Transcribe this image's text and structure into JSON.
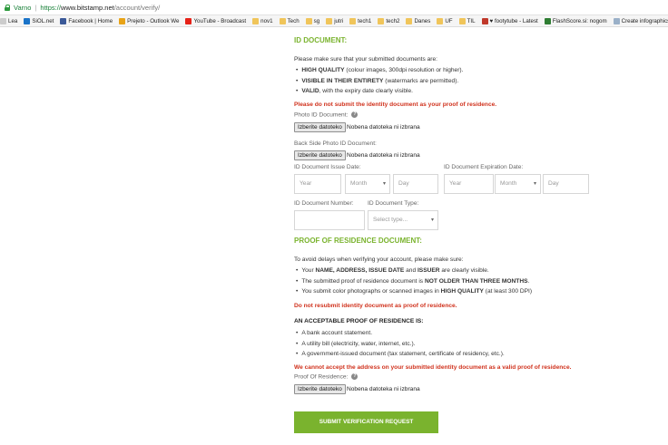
{
  "browser": {
    "security_label": "Varno",
    "url_scheme": "https://",
    "url_domain": "www.bitstamp.net",
    "url_path": "/account/verify/"
  },
  "bookmarks": [
    {
      "label": "Lea",
      "icon": "app-icon",
      "color": "#cccccc"
    },
    {
      "label": "SiOL.net",
      "icon": "siol-icon",
      "color": "#1a73c8"
    },
    {
      "label": "Facebook | Home",
      "icon": "facebook-icon",
      "color": "#3b5998"
    },
    {
      "label": "Prejeto - Outlook We",
      "icon": "outlook-icon",
      "color": "#e8a317"
    },
    {
      "label": "YouTube - Broadcast",
      "icon": "youtube-icon",
      "color": "#e62117"
    },
    {
      "label": "nov1",
      "icon": "folder-icon",
      "color": "#f0c55a"
    },
    {
      "label": "Tech",
      "icon": "folder-icon",
      "color": "#f0c55a"
    },
    {
      "label": "sg",
      "icon": "folder-icon",
      "color": "#f0c55a"
    },
    {
      "label": "jutri",
      "icon": "folder-icon",
      "color": "#f0c55a"
    },
    {
      "label": "tech1",
      "icon": "folder-icon",
      "color": "#f0c55a"
    },
    {
      "label": "tech2",
      "icon": "folder-icon",
      "color": "#f0c55a"
    },
    {
      "label": "Danes",
      "icon": "folder-icon",
      "color": "#f0c55a"
    },
    {
      "label": "UF",
      "icon": "folder-icon",
      "color": "#f0c55a"
    },
    {
      "label": "TIL",
      "icon": "folder-icon",
      "color": "#f0c55a"
    },
    {
      "label": "♥ footytube - Latest",
      "icon": "footytube-icon",
      "color": "#c0392b"
    },
    {
      "label": "FlashScore.si: nogom",
      "icon": "flashscore-icon",
      "color": "#2e7d32"
    },
    {
      "label": "Create infographics &",
      "icon": "infographics-icon",
      "color": "#9ab0c8"
    }
  ],
  "id_document": {
    "heading": "ID DOCUMENT:",
    "intro": "Please make sure that your submitted documents are:",
    "bullets": [
      {
        "bold": "HIGH QUALITY",
        "rest": " (colour images, 300dpi resolution or higher)."
      },
      {
        "bold": "VISIBLE IN THEIR ENTIRETY",
        "rest": " (watermarks are permitted)."
      },
      {
        "bold": "VALID",
        "rest": ", with the expiry date clearly visible."
      }
    ],
    "warning": "Please do not submit the identity document as your proof of residence.",
    "photo_label": "Photo ID Document:",
    "back_label": "Back Side Photo ID Document:",
    "choose_file": "Izberite datoteko",
    "no_file": "Nobena datoteka ni izbrana",
    "issue_label": "ID Document Issue Date:",
    "expiry_label": "ID Document Expiration Date:",
    "year_ph": "Year",
    "month_ph": "Month",
    "day_ph": "Day",
    "number_label": "ID Document Number:",
    "type_label": "ID Document Type:",
    "type_ph": "Select type..."
  },
  "residence": {
    "heading": "PROOF OF RESIDENCE DOCUMENT:",
    "intro": "To avoid delays when verifying your account, please make sure:",
    "b1_pre": "Your ",
    "b1_bold1": "NAME, ADDRESS, ISSUE DATE",
    "b1_mid": " and ",
    "b1_bold2": "ISSUER",
    "b1_post": " are clearly visible.",
    "b2_pre": "The submitted proof of residence document is ",
    "b2_bold": "NOT OLDER THAN THREE MONTHS",
    "b2_post": ".",
    "b3_pre": "You submit color photographs or scanned images in ",
    "b3_bold": "HIGH QUALITY",
    "b3_post": " (at least 300 DPI)",
    "warning1": "Do not resubmit identity document as proof of residence.",
    "acceptable_heading": "AN ACCEPTABLE PROOF OF RESIDENCE IS:",
    "acceptable": [
      "A bank account statement.",
      "A utility bill (electricity, water, internet, etc.).",
      "A government-issued document (tax statement, certificate of residency, etc.)."
    ],
    "warning2": "We cannot accept the address on your submitted identity document as a valid proof of residence.",
    "proof_label": "Proof Of Residence:",
    "choose_file": "Izberite datoteko",
    "no_file": "Nobena datoteka ni izbrana"
  },
  "submit_label": "SUBMIT VERIFICATION REQUEST",
  "colors": {
    "accent": "#7ab32e",
    "warning": "#d0321d"
  }
}
